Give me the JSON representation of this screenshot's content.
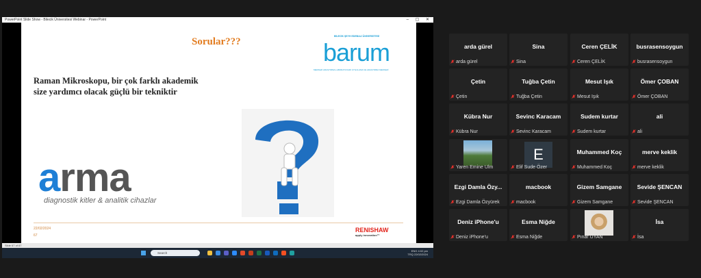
{
  "powerpoint": {
    "title_bar": "PowerPoint Slide Show - Bilecik Üniversitesi Webinar - PowerPoint",
    "status_bar": "Slide 67 of 67"
  },
  "slide": {
    "heading": "Sorular???",
    "body_line1": "Raman Mikroskopu, bir çok farklı akademik",
    "body_line2": "size yardımcı olacak güçlü bir tekniktir",
    "barum_subtitle": "BİLECİK ŞEYH EDEBALİ ÜNİVERSİTESİ",
    "barum_word": "barum",
    "barum_caption": "MERKEZİ ARAŞTIRMA LABORATUVARI UYGULAMA VE ARAŞTIRMA MERKEZİ",
    "arma_logo_rest": "rma",
    "arma_logo_a": "a",
    "arma_tagline": "diagnostik kitler & analitik cihazlar",
    "date": "22/02/2024",
    "page_number": "67",
    "renishaw": "RENISHAW",
    "renishaw_tagline": "apply innovation™"
  },
  "taskbar": {
    "search_placeholder": "Search",
    "tray_lang": "ENG",
    "tray_region": "TRQ",
    "tray_time": "4:02 pm",
    "tray_date": "22/02/2024"
  },
  "participants": [
    {
      "display": "arda gürel",
      "label": "arda gürel"
    },
    {
      "display": "Sina",
      "label": "Sina"
    },
    {
      "display": "Ceren ÇELİK",
      "label": "Ceren ÇELİK"
    },
    {
      "display": "busrasensoygun",
      "label": "busrasensoygun"
    },
    {
      "display": "Çetin",
      "label": "Çetin"
    },
    {
      "display": "Tuğba Çetin",
      "label": "Tuğba Çetin"
    },
    {
      "display": "Mesut Işık",
      "label": "Mesut Işık"
    },
    {
      "display": "Ömer ÇOBAN",
      "label": "Ömer ÇOBAN"
    },
    {
      "display": "Kübra Nur",
      "label": "Kübra Nur"
    },
    {
      "display": "Sevinc Karacam",
      "label": "Sevinc Karacam"
    },
    {
      "display": "Sudem kurtar",
      "label": "Sudem kurtar"
    },
    {
      "display": "ali",
      "label": "ali"
    },
    {
      "display": "",
      "label": "Yaren Emine Ulm"
    },
    {
      "display": "E",
      "label": "Elif Sude Özer"
    },
    {
      "display": "Muhammed Koç",
      "label": "Muhammed Koç"
    },
    {
      "display": "merve keklik",
      "label": "merve keklik"
    },
    {
      "display": "Ezgi Damla Özy...",
      "label": "Ezgi Damla Özyürek"
    },
    {
      "display": "macbook",
      "label": "macbook"
    },
    {
      "display": "Gizem Samgane",
      "label": "Gizem Samgane"
    },
    {
      "display": "Sevide ŞENCAN",
      "label": "Sevide ŞENCAN"
    },
    {
      "display": "Deniz iPhone'u",
      "label": "Deniz iPhone'u"
    },
    {
      "display": "Esma Niğde",
      "label": "Esma Niğde"
    },
    {
      "display": "",
      "label": "Pınar UYAN"
    },
    {
      "display": "İsa",
      "label": "İsa"
    }
  ],
  "colors": {
    "accent_orange": "#e27b1e",
    "barum_blue": "#1a9fd6",
    "mute_red": "#e0312b"
  }
}
